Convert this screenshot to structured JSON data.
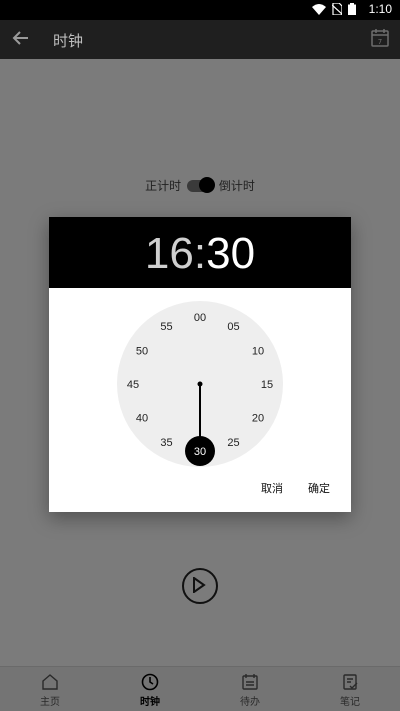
{
  "status_bar": {
    "time": "1:10"
  },
  "app_bar": {
    "title": "时钟"
  },
  "toggle": {
    "left_label": "正计时",
    "right_label": "倒计时"
  },
  "dialog": {
    "hour": "16",
    "separator": ":",
    "minute": "30",
    "dial_labels": [
      "00",
      "05",
      "10",
      "15",
      "20",
      "25",
      "30",
      "35",
      "40",
      "45",
      "50",
      "55"
    ],
    "selected": "30",
    "cancel_label": "取消",
    "ok_label": "确定"
  },
  "bottom_nav": {
    "items": [
      {
        "label": "主页",
        "icon": "home-icon"
      },
      {
        "label": "时钟",
        "icon": "clock-icon",
        "active": true
      },
      {
        "label": "待办",
        "icon": "calendar-list-icon"
      },
      {
        "label": "笔记",
        "icon": "note-check-icon"
      }
    ]
  },
  "colors": {
    "accent": "#000000",
    "dial": "#eeeeee",
    "scrim": "#7b7b7b"
  }
}
